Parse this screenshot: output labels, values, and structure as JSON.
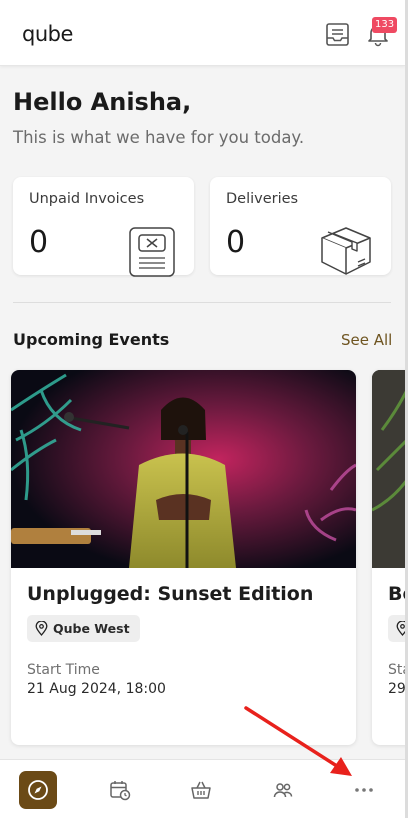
{
  "header": {
    "logo": "qube",
    "notifications_count": "133"
  },
  "greeting": {
    "title": "Hello Anisha,",
    "subtitle": "This is what we have for you today."
  },
  "stats": [
    {
      "label": "Unpaid Invoices",
      "value": "0"
    },
    {
      "label": "Deliveries",
      "value": "0"
    }
  ],
  "events_section": {
    "title": "Upcoming Events",
    "see_all": "See All"
  },
  "events": [
    {
      "title": "Unplugged: Sunset Edition",
      "location": "Qube West",
      "start_label": "Start Time",
      "start_value": "21 Aug 2024, 18:00"
    },
    {
      "title": "Be",
      "location": "",
      "start_label": "Sta",
      "start_value": "29"
    }
  ],
  "bottom_nav": [
    "explore-icon",
    "calendar-clock-icon",
    "basket-icon",
    "people-icon",
    "more-icon"
  ],
  "colors": {
    "accent": "#6b4a16",
    "see_all": "#6e5420",
    "badge": "#ef4a62",
    "annotation_arrow": "#e8211c"
  }
}
